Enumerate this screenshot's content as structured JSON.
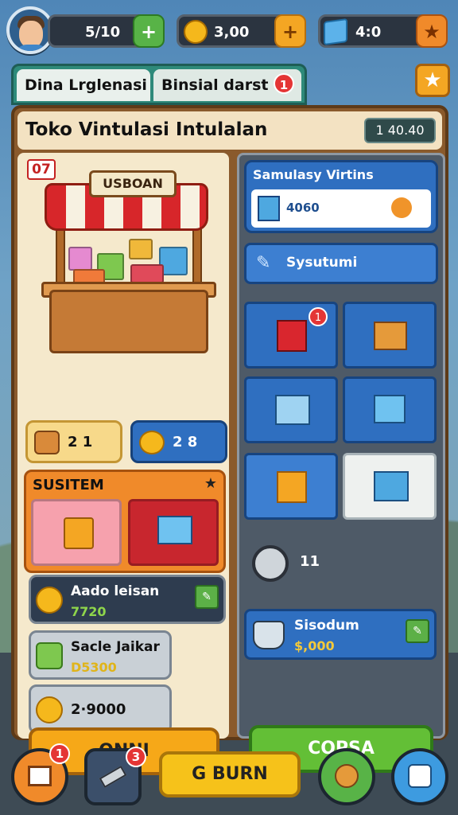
{
  "resources": [
    {
      "value": "5/10",
      "plus": "+"
    },
    {
      "value": "3,00",
      "plus": "+"
    },
    {
      "value": "4:0",
      "plus": "★"
    }
  ],
  "tabs": [
    {
      "label": "Dina Lrglenasi"
    },
    {
      "label": "Binsial darst"
    }
  ],
  "tab_badge": "1",
  "star_button": "★",
  "panel": {
    "title": "Toko Vintulasi Intulalan",
    "count": "1 40.40",
    "corner_badge": "07",
    "stall_sign": "USBOAN"
  },
  "chips": [
    {
      "value": "2 1"
    },
    {
      "value": "2 8"
    }
  ],
  "system": {
    "title": "SUSITEM",
    "star": "★"
  },
  "rows": [
    {
      "title": "Aado leisan",
      "amount": "7720"
    },
    {
      "title": "Sacle Jaikar",
      "amount": "D5300"
    },
    {
      "title": "",
      "amount": "2·9000"
    }
  ],
  "left_button": "ONNI",
  "right": {
    "box_title": "Samulasy Virtins",
    "box_value": "4060",
    "bar_label": "Sysutumi",
    "tile_badge": "1",
    "knob_value": "11",
    "sys_title": "Sisodum",
    "sys_amount": "$,000",
    "button": "COPSA"
  },
  "nav": {
    "home_badge": "1",
    "tool_badge": "3",
    "center_label": "G BURN"
  },
  "colors": {
    "panel": "#8a5a2c",
    "accent_orange": "#f6a818",
    "accent_green": "#63bf36",
    "accent_blue": "#2f6fc0",
    "badge_red": "#e43535"
  }
}
